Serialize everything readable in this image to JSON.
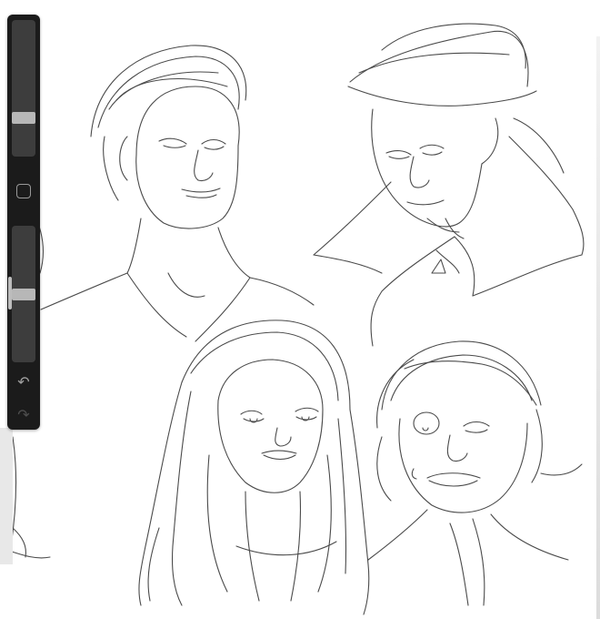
{
  "app": {
    "type": "digital drawing canvas"
  },
  "sidebar": {
    "brush_size": {
      "icon": "brush-size-slider",
      "value": 0.28
    },
    "modify_button": {
      "icon": "square-outline-icon"
    },
    "brush_opacity": {
      "icon": "brush-opacity-slider",
      "value": 0.53
    },
    "undo": {
      "icon": "undo-arrow-icon",
      "glyph": "↶"
    },
    "redo": {
      "icon": "redo-arrow-icon",
      "glyph": "↷"
    }
  },
  "canvas": {
    "content": "pencil sketches",
    "stroke_color": "#4a4a4a",
    "background_color": "#ffffff"
  },
  "colors": {
    "sidebar": "#1b1b1b",
    "slider_track": "#3d3d3d",
    "slider_thumb": "#b7b7b7"
  }
}
